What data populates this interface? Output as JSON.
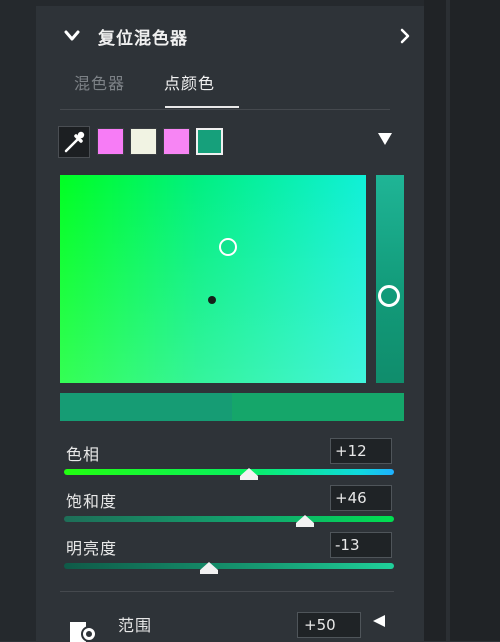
{
  "header": {
    "title": "复位混色器",
    "collapse_icon": "chevron-down-icon",
    "expand_icon": "chevron-right-icon"
  },
  "tabs": [
    {
      "label": "混色器",
      "active": false
    },
    {
      "label": "点颜色",
      "active": true
    }
  ],
  "swatches": {
    "eyedropper_icon": "eyedropper-icon",
    "colors": [
      "#f77cf6",
      "#f1f3e3",
      "#f785f4",
      "#16a07b"
    ],
    "selected_index": 3,
    "dropdown_icon": "triangle-down-icon"
  },
  "picker": {
    "gradient_colors": [
      "#00ff22",
      "#00f080",
      "#10f0d8"
    ]
  },
  "compare": {
    "original": "#169c74",
    "current": "#15a66a"
  },
  "sliders": [
    {
      "label": "色相",
      "value": "+12",
      "level": 0.56
    },
    {
      "label": "饱和度",
      "value": "+46",
      "level": 0.73
    },
    {
      "label": "明亮度",
      "value": "-13",
      "level": 0.44
    }
  ],
  "range": {
    "label": "范围",
    "value": "+50",
    "icon": "range-icon",
    "arrow_icon": "triangle-left-icon"
  }
}
